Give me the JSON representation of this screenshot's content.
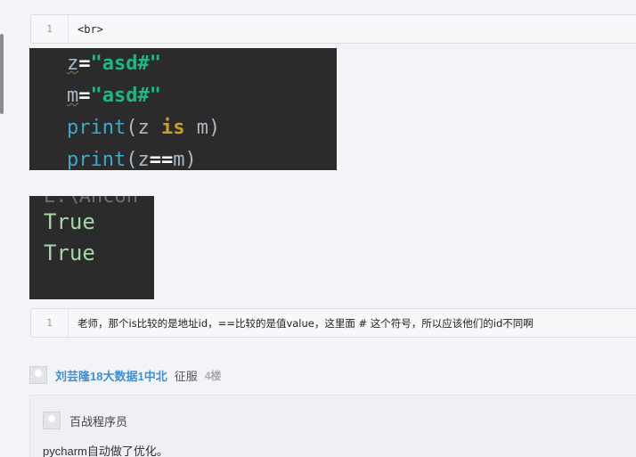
{
  "code_blocks": [
    {
      "line_no": "1",
      "text": "<br>"
    },
    {
      "line_no": "1",
      "text": "老师，那个is比较的是地址id，==比较的是值value，这里面 # 这个符号，所以应该他们的id不同啊"
    }
  ],
  "ide_code": {
    "line1": {
      "var": "z",
      "op": "=",
      "str": "\"asd#\""
    },
    "line2": {
      "var": "m",
      "op": "=",
      "str": "\"asd#\""
    },
    "line3": {
      "fn": "print",
      "open": "(",
      "a": "z",
      "kw": "is",
      "b": "m",
      "close": ")"
    },
    "line4": {
      "fn": "print",
      "open": "(",
      "a": "z",
      "op": "==",
      "b": "m",
      "close": ")"
    }
  },
  "console": {
    "cut_text": "E:\\Ancon",
    "out1": "True",
    "out2": "True"
  },
  "comment": {
    "author": "刘芸隆18大数据1中北",
    "title": "征服",
    "floor": "4楼"
  },
  "reply": {
    "author": "百战程序员",
    "text": "pycharm自动做了优化。"
  }
}
